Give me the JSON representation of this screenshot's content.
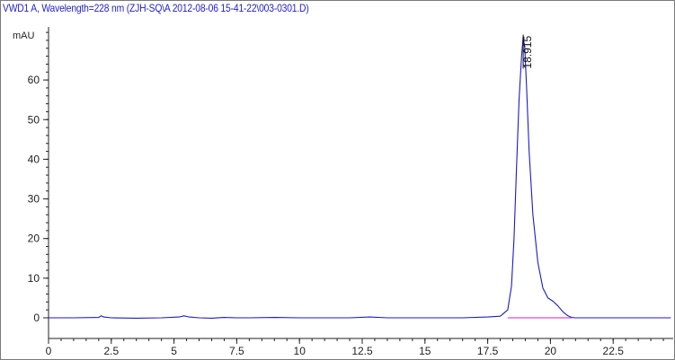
{
  "chart_data": {
    "type": "line",
    "title": "VWD1 A, Wavelength=228 nm (ZJH-SQ\\A 2012-08-06 15-41-22\\003-0301.D)",
    "ylabel": "mAU",
    "xlabel": "",
    "xlim": [
      0,
      24.8
    ],
    "ylim": [
      -3,
      73
    ],
    "x_ticks": [
      0,
      2.5,
      5,
      7.5,
      10,
      12.5,
      15,
      17.5,
      20,
      22.5
    ],
    "x_tick_labels": [
      "0",
      "2.5",
      "5",
      "7.5",
      "10",
      "12.5",
      "15",
      "17.5",
      "20",
      "22.5"
    ],
    "y_ticks": [
      0,
      10,
      20,
      30,
      40,
      50,
      60
    ],
    "y_tick_labels": [
      "0",
      "10",
      "20",
      "30",
      "40",
      "50",
      "60"
    ],
    "x_minor_step": 0.5,
    "y_minor_step": 2,
    "grid": false,
    "peak_label": "18.915",
    "series": [
      {
        "color": "#1a1ad0",
        "x": [
          0,
          1.0,
          2.0,
          2.1,
          2.2,
          2.5,
          3.5,
          4.5,
          5.2,
          5.4,
          5.6,
          6.0,
          6.5,
          7.0,
          7.5,
          8.0,
          9.0,
          10.0,
          11.0,
          12.0,
          12.8,
          13.5,
          14.5,
          15.5,
          16.5,
          17.5,
          18.0,
          18.3,
          18.45,
          18.55,
          18.65,
          18.75,
          18.85,
          18.915,
          18.98,
          19.05,
          19.15,
          19.3,
          19.5,
          19.7,
          19.9,
          20.1,
          20.3,
          20.5,
          20.7,
          20.85,
          21.0,
          22.0,
          23.0,
          24.8
        ],
        "y": [
          0,
          0,
          0.1,
          0.5,
          0.2,
          0,
          -0.1,
          0,
          0.2,
          0.5,
          0.2,
          0,
          -0.1,
          0.1,
          0,
          0,
          0.1,
          0,
          0,
          0,
          0.2,
          0,
          0,
          0,
          0,
          0.2,
          0.4,
          2,
          8,
          20,
          38,
          55,
          66,
          71,
          68,
          58,
          42,
          26,
          14,
          7.5,
          5,
          4.2,
          3,
          1.5,
          0.5,
          0.1,
          0,
          0,
          0,
          0
        ]
      },
      {
        "color": "#d020c8",
        "x": [
          18.3,
          20.85
        ],
        "y": [
          0,
          0
        ]
      }
    ]
  }
}
